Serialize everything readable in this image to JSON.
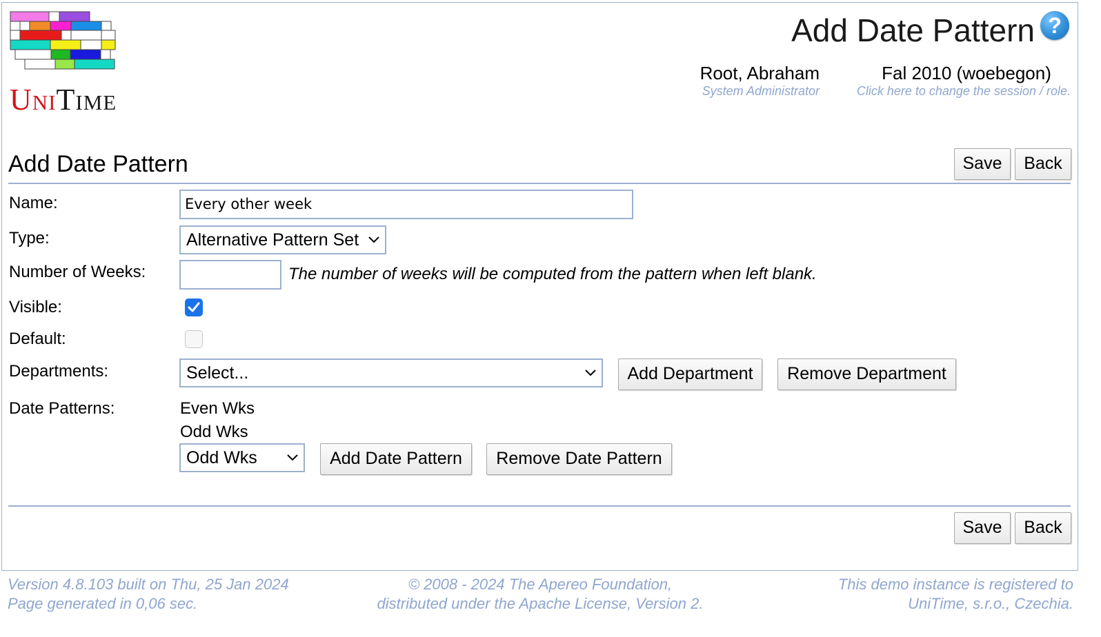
{
  "app": {
    "logo_uni": "Uni",
    "logo_time": "Time"
  },
  "header": {
    "title": "Add Date Pattern",
    "help_icon": "help-question-icon",
    "user_name": "Root, Abraham",
    "user_role": "System Administrator",
    "session_name": "Fal 2010 (woebegon)",
    "session_hint": "Click here to change the session / role."
  },
  "section": {
    "title": "Add Date Pattern",
    "save_label": "Save",
    "back_label": "Back"
  },
  "form": {
    "name_label": "Name:",
    "name_value": "Every other week",
    "type_label": "Type:",
    "type_value": "Alternative Pattern Set",
    "weeks_label": "Number of Weeks:",
    "weeks_value": "",
    "weeks_hint": "The number of weeks will be computed from the pattern when left blank.",
    "visible_label": "Visible:",
    "visible_checked": true,
    "default_label": "Default:",
    "default_checked": false,
    "departments_label": "Departments:",
    "departments_select": "Select...",
    "add_department_label": "Add Department",
    "remove_department_label": "Remove Department",
    "date_patterns_label": "Date Patterns:",
    "date_patterns": [
      "Even Wks",
      "Odd Wks"
    ],
    "date_pattern_select": "Odd Wks",
    "add_date_pattern_label": "Add Date Pattern",
    "remove_date_pattern_label": "Remove Date Pattern"
  },
  "bottom": {
    "save_label": "Save",
    "back_label": "Back"
  },
  "footer": {
    "version_line": "Version 4.8.103 built on Thu, 25 Jan 2024",
    "generated_line": "Page generated in 0,06 sec.",
    "copyright_line": "© 2008 - 2024 The Apereo Foundation,",
    "license_line": "distributed under the Apache License, Version 2.",
    "registered_line": "This demo instance is registered to",
    "registered_org": "UniTime, s.r.o., Czechia."
  },
  "colors": {
    "accent_border": "#9cb0ce",
    "muted_text": "#8fa6cf",
    "checkbox_blue": "#1a73e8",
    "logo_red": "#d4141b"
  }
}
